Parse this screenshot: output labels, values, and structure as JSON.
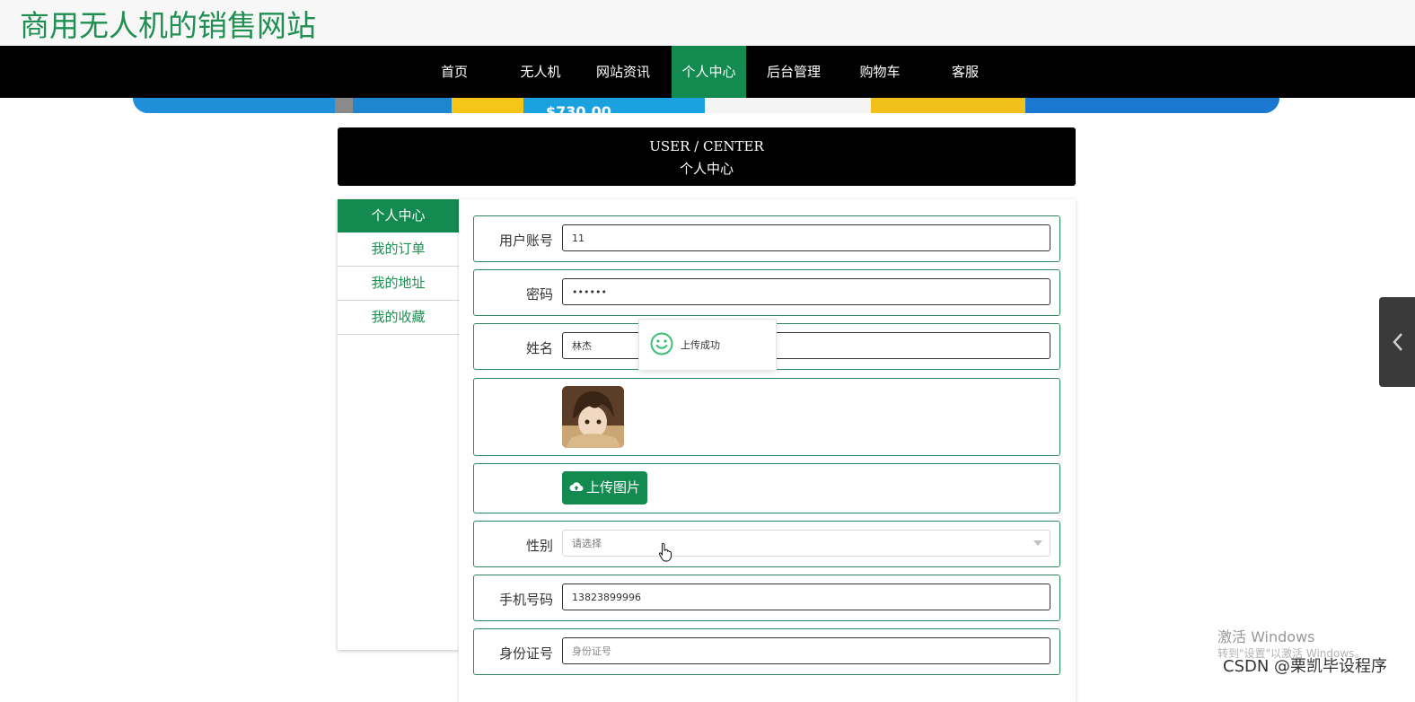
{
  "site": {
    "title": "商用无人机的销售网站"
  },
  "nav": {
    "items": [
      {
        "label": "首页"
      },
      {
        "label": "无人机"
      },
      {
        "label": "网站资讯"
      },
      {
        "label": "个人中心",
        "active": true
      },
      {
        "label": "后台管理"
      },
      {
        "label": "购物车"
      },
      {
        "label": "客服"
      }
    ]
  },
  "banner": {
    "text_fragment": "$730.00"
  },
  "user_center": {
    "title_en": "USER / CENTER",
    "title_cn": "个人中心"
  },
  "sidebar": {
    "items": [
      {
        "label": "个人中心",
        "active": true
      },
      {
        "label": "我的订单"
      },
      {
        "label": "我的地址"
      },
      {
        "label": "我的收藏"
      }
    ]
  },
  "form": {
    "account": {
      "label": "用户账号",
      "value": "11"
    },
    "password": {
      "label": "密码",
      "value": "••••••"
    },
    "name": {
      "label": "姓名",
      "value": "林杰"
    },
    "upload": {
      "label": "上传图片"
    },
    "gender": {
      "label": "性别",
      "placeholder": "请选择"
    },
    "phone": {
      "label": "手机号码",
      "value": "13823899996"
    },
    "idcard": {
      "label": "身份证号",
      "placeholder": "身份证号"
    }
  },
  "toast": {
    "text": "上传成功"
  },
  "watermark": {
    "line1": "激活 Windows",
    "line2": "转到\"设置\"以激活 Windows。",
    "credit": "CSDN @栗凯毕设程序"
  },
  "colors": {
    "brand": "#138a50",
    "brand_text": "#1f8f52",
    "nav_bg": "#000000"
  },
  "icons": [
    "cloud-upload-icon",
    "smile-icon",
    "chevron-left-icon",
    "chevron-down-icon",
    "pointer-cursor-icon"
  ]
}
